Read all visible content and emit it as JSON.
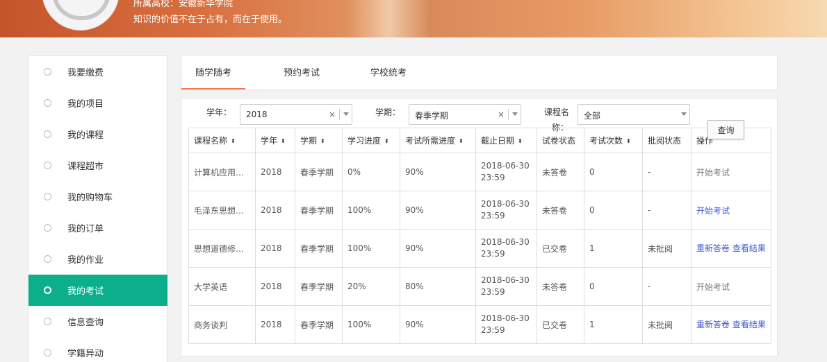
{
  "banner": {
    "school_line": "所属高校：安徽新华学院",
    "motto": "知识的价值不在于占有，而在于使用。"
  },
  "sidebar": {
    "items": [
      {
        "label": "我要缴费"
      },
      {
        "label": "我的项目"
      },
      {
        "label": "我的课程"
      },
      {
        "label": "课程超市"
      },
      {
        "label": "我的购物车"
      },
      {
        "label": "我的订单"
      },
      {
        "label": "我的作业"
      },
      {
        "label": "我的考试"
      },
      {
        "label": "信息查询"
      },
      {
        "label": "学籍异动"
      }
    ],
    "active_index": 7
  },
  "tabs": [
    {
      "label": "随学随考"
    },
    {
      "label": "预约考试"
    },
    {
      "label": "学校统考"
    }
  ],
  "filters": {
    "year": {
      "label": "学年：",
      "value": "2018",
      "clear": "×"
    },
    "term": {
      "label": "学期：",
      "value": "春季学期",
      "clear": "×"
    },
    "course": {
      "label_line1": "课程名",
      "label_line2": "称：",
      "value": "全部"
    },
    "query_button": "查询"
  },
  "table": {
    "headers": [
      "课程名称",
      "学年",
      "学期",
      "学习进度",
      "考试所需进度",
      "截止日期",
      "试卷状态",
      "考试次数",
      "批阅状态",
      "操作"
    ],
    "sort_icon": "⬍",
    "rows": [
      {
        "name": "计算机应用基础",
        "year": "2018",
        "term": "春季学期",
        "progress": "0%",
        "required": "90%",
        "date": "2018-06-30",
        "time": "23:59",
        "paper": "未答卷",
        "count": "0",
        "review": "-",
        "action1": "开始考试",
        "action2": ""
      },
      {
        "name": "毛泽东思想和中国特色社会主义理论体系概论",
        "year": "2018",
        "term": "春季学期",
        "progress": "100%",
        "required": "90%",
        "date": "2018-06-30",
        "time": "23:59",
        "paper": "未答卷",
        "count": "0",
        "review": "-",
        "action1": "开始考试",
        "action2": ""
      },
      {
        "name": "思想道德修养与法律基础",
        "year": "2018",
        "term": "春季学期",
        "progress": "100%",
        "required": "90%",
        "date": "2018-06-30",
        "time": "23:59",
        "paper": "已交卷",
        "count": "1",
        "review": "未批阅",
        "action1": "重新答卷",
        "action2": "查看结果"
      },
      {
        "name": "大学英语",
        "year": "2018",
        "term": "春季学期",
        "progress": "20%",
        "required": "80%",
        "date": "2018-06-30",
        "time": "23:59",
        "paper": "未答卷",
        "count": "0",
        "review": "-",
        "action1": "开始考试",
        "action2": ""
      },
      {
        "name": "商务谈判",
        "year": "2018",
        "term": "春季学期",
        "progress": "100%",
        "required": "90%",
        "date": "2018-06-30",
        "time": "23:59",
        "paper": "已交卷",
        "count": "1",
        "review": "未批阅",
        "action1": "重新答卷",
        "action2": "查看结果"
      }
    ]
  }
}
